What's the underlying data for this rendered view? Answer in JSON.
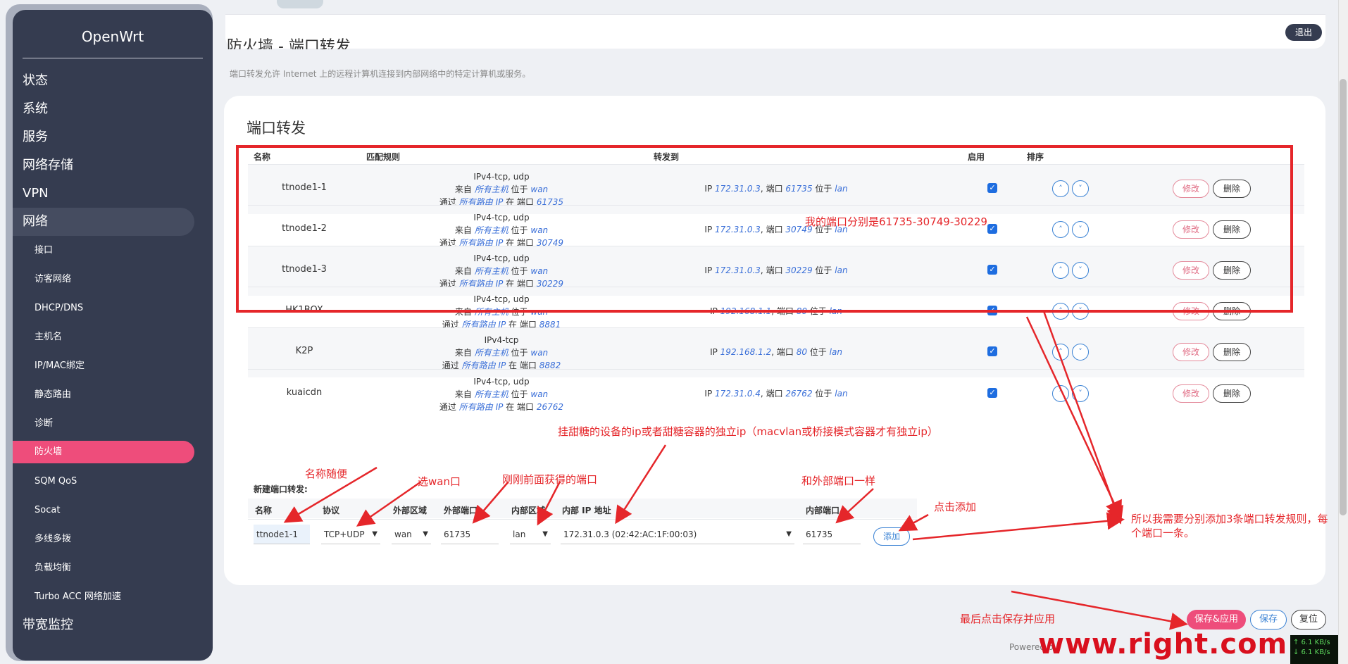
{
  "sidebar": {
    "brand": "OpenWrt",
    "top_items": [
      "状态",
      "系统",
      "服务",
      "网络存储",
      "VPN",
      "网络"
    ],
    "sub_items": [
      "接口",
      "访客网络",
      "DHCP/DNS",
      "主机名",
      "IP/MAC绑定",
      "静态路由",
      "诊断",
      "防火墙",
      "SQM QoS",
      "Socat",
      "多线多拨",
      "负载均衡",
      "Turbo ACC 网络加速"
    ],
    "bottom_item": "带宽监控",
    "active_top": "网络",
    "active_sub": "防火墙"
  },
  "header": {
    "logout": "退出",
    "page_title": "防火墙 - 端口转发",
    "description": "端口转发允许 Internet 上的远程计算机连接到内部网络中的特定计算机或服务。"
  },
  "table": {
    "section_title": "端口转发",
    "headers": {
      "name": "名称",
      "match": "匹配规则",
      "forward": "转发到",
      "enable": "启用",
      "sort": "排序"
    },
    "rows": [
      {
        "name": "ttnode1-1",
        "proto": "IPv4-tcp, udp",
        "src_host": "所有主机",
        "src_zone": "wan",
        "via_ip": "所有路由 IP",
        "ext_port": "61735",
        "ip": "172.31.0.3",
        "port": "61735",
        "zone": "lan",
        "enabled": true
      },
      {
        "name": "ttnode1-2",
        "proto": "IPv4-tcp, udp",
        "src_host": "所有主机",
        "src_zone": "wan",
        "via_ip": "所有路由 IP",
        "ext_port": "30749",
        "ip": "172.31.0.3",
        "port": "30749",
        "zone": "lan",
        "enabled": true
      },
      {
        "name": "ttnode1-3",
        "proto": "IPv4-tcp, udp",
        "src_host": "所有主机",
        "src_zone": "wan",
        "via_ip": "所有路由 IP",
        "ext_port": "30229",
        "ip": "172.31.0.3",
        "port": "30229",
        "zone": "lan",
        "enabled": true
      },
      {
        "name": "HK1BOX",
        "proto": "IPv4-tcp, udp",
        "src_host": "所有主机",
        "src_zone": "wan",
        "via_ip": "所有路由 IP",
        "ext_port": "8881",
        "ip": "192.168.1.1",
        "port": "80",
        "zone": "lan",
        "enabled": true
      },
      {
        "name": "K2P",
        "proto": "IPv4-tcp",
        "src_host": "所有主机",
        "src_zone": "wan",
        "via_ip": "所有路由 IP",
        "ext_port": "8882",
        "ip": "192.168.1.2",
        "port": "80",
        "zone": "lan",
        "enabled": true
      },
      {
        "name": "kuaicdn",
        "proto": "IPv4-tcp, udp",
        "src_host": "所有主机",
        "src_zone": "wan",
        "via_ip": "所有路由 IP",
        "ext_port": "26762",
        "ip": "172.31.0.4",
        "port": "26762",
        "zone": "lan",
        "enabled": true
      }
    ],
    "words": {
      "from": "来自",
      "at": "位于",
      "via": "通过",
      "on": "在",
      "port_label": "端口",
      "ip_label": "IP",
      "port_prefix": "端口"
    },
    "edit": "修改",
    "delete": "删除",
    "up": "˄",
    "down": "˅"
  },
  "new_forward": {
    "title": "新建端口转发:",
    "labels": {
      "name": "名称",
      "proto": "协议",
      "ext_zone": "外部区域",
      "ext_port": "外部端口",
      "int_zone": "内部区域",
      "int_ip": "内部 IP 地址",
      "int_port": "内部端口"
    },
    "values": {
      "name": "ttnode1-1",
      "proto": "TCP+UDP",
      "ext_zone": "wan",
      "ext_port": "61735",
      "int_zone": "lan",
      "int_ip": "172.31.0.3 (02:42:AC:1F:00:03)",
      "int_port": "61735"
    },
    "add": "添加"
  },
  "actions": {
    "save_apply": "保存&应用",
    "save": "保存",
    "reset": "复位"
  },
  "footer": {
    "text": "Powered by"
  },
  "watermark": "www.right.com.cn",
  "netspeed": {
    "up": "↑ 6.1 KB/s",
    "down": "↓ 6.1 KB/s"
  },
  "annotations": {
    "ports": "我的端口分别是61735-30749-30229",
    "name_any": "名称随便",
    "pick_wan": "选wan口",
    "got_port": "刚刚前面获得的端口",
    "ip_note": "挂甜糖的设备的ip或者甜糖容器的独立ip（macvlan或桥接模式容器才有独立ip）",
    "same_port": "和外部端口一样",
    "click_add": "点击添加",
    "need_three": "所以我需要分别添加3条端口转发规则，每",
    "need_three_2": "个端口一条。",
    "save_last": "最后点击保存并应用"
  },
  "colors": {
    "sidebar_bg": "#353c50",
    "accent_pink": "#ee4d7b",
    "link_blue": "#3a6fd8",
    "annotation_red": "#e5262a"
  }
}
